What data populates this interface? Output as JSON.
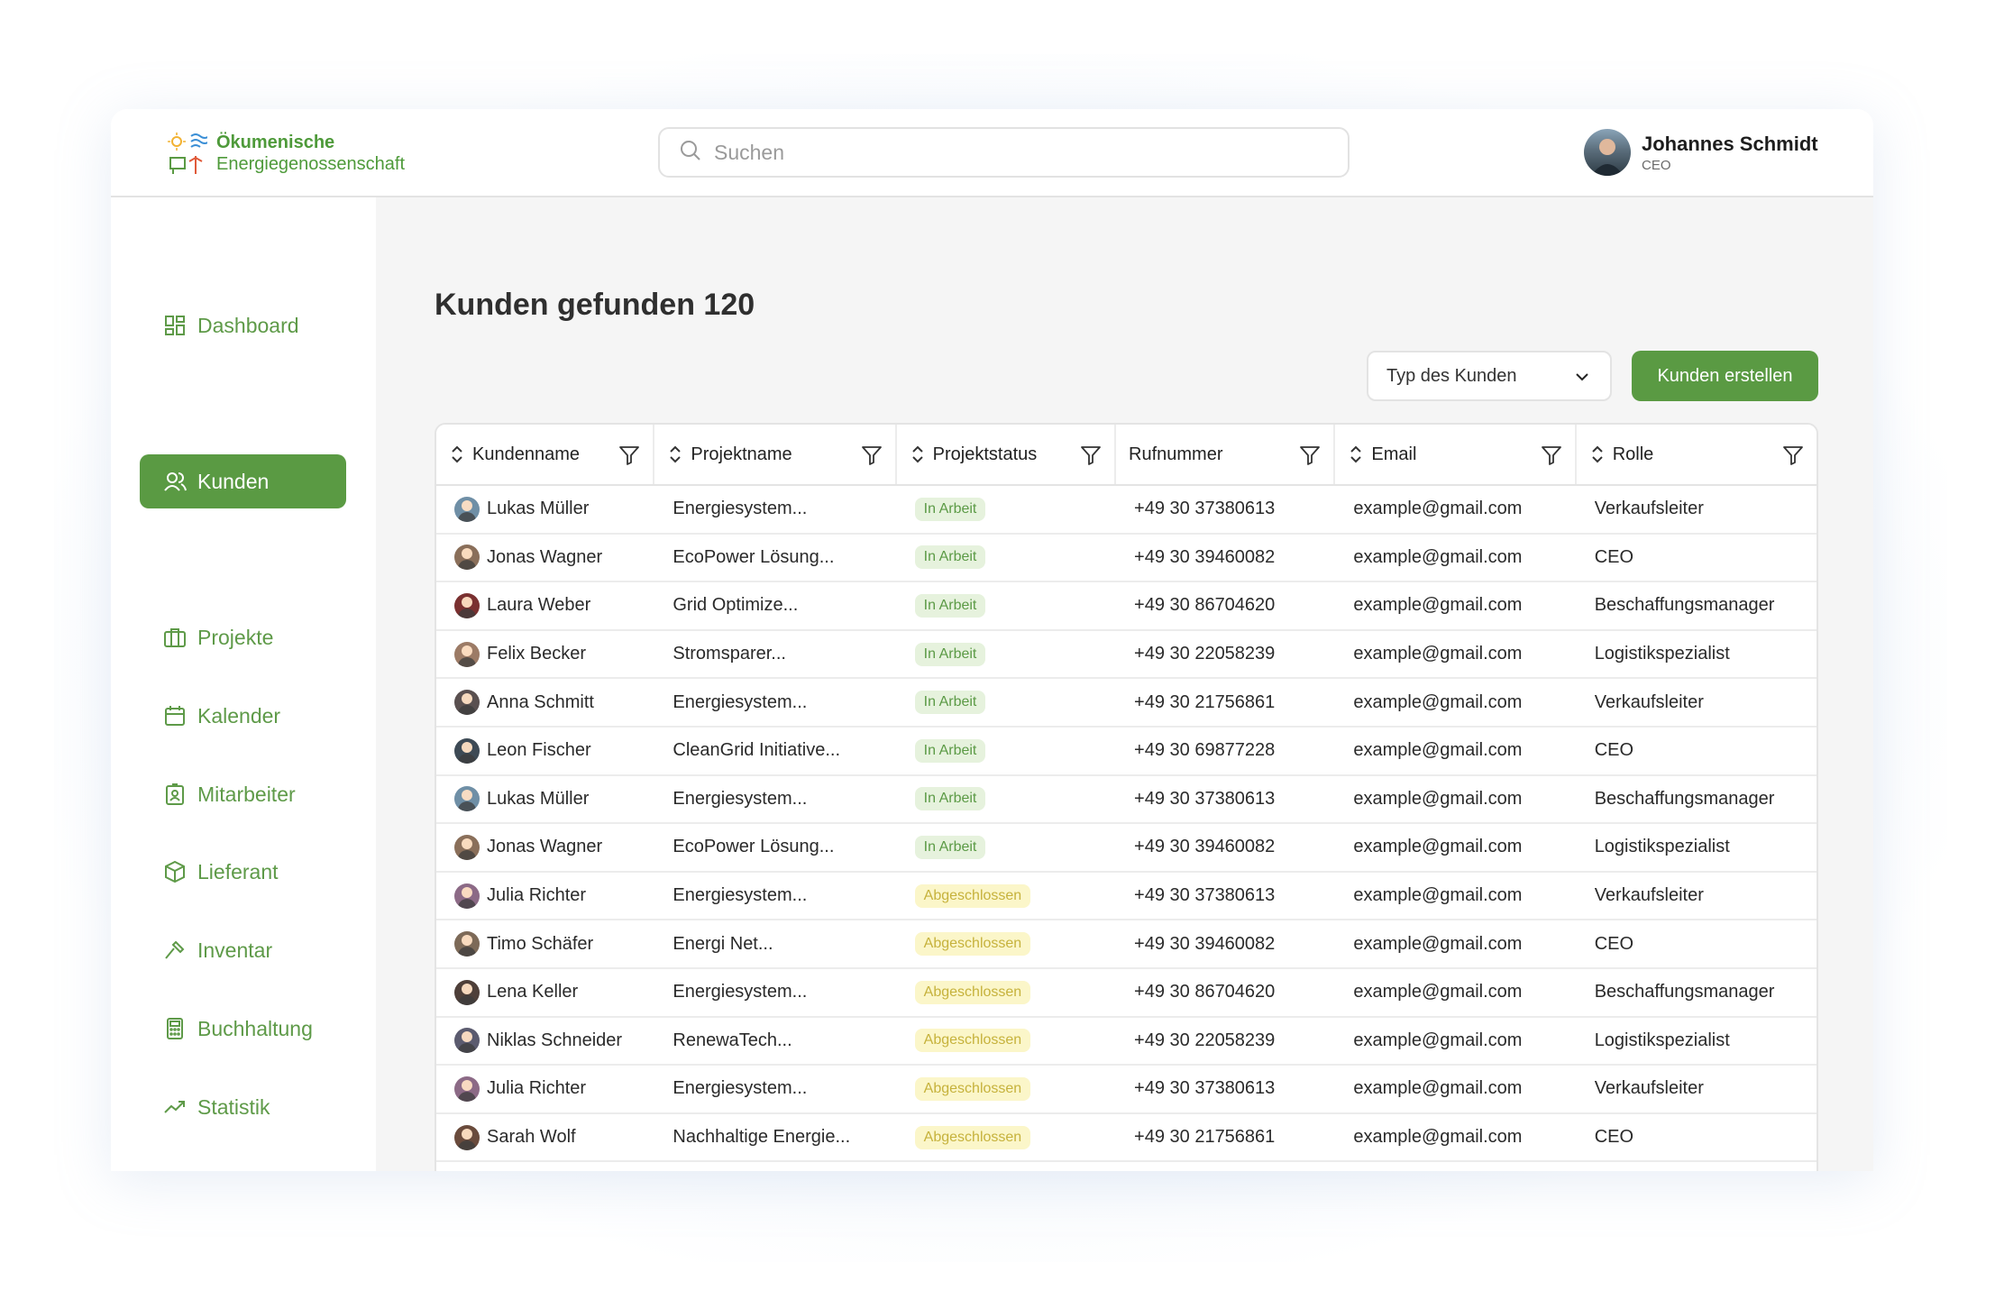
{
  "brand": {
    "line1": "Ökumenische",
    "line2": "Energiegenossenschaft"
  },
  "search": {
    "placeholder": "Suchen"
  },
  "user": {
    "name": "Johannes Schmidt",
    "role": "CEO"
  },
  "sidebar": {
    "items": [
      {
        "label": "Dashboard",
        "icon": "dashboard-icon",
        "active": false
      },
      {
        "label": "Kunden",
        "icon": "users-icon",
        "active": true
      },
      {
        "label": "Projekte",
        "icon": "briefcase-icon",
        "active": false
      },
      {
        "label": "Kalender",
        "icon": "calendar-icon",
        "active": false
      },
      {
        "label": "Mitarbeiter",
        "icon": "id-badge-icon",
        "active": false
      },
      {
        "label": "Lieferant",
        "icon": "box-icon",
        "active": false
      },
      {
        "label": "Inventar",
        "icon": "hammer-icon",
        "active": false
      },
      {
        "label": "Buchhaltung",
        "icon": "calculator-icon",
        "active": false
      },
      {
        "label": "Statistik",
        "icon": "trend-up-icon",
        "active": false
      }
    ]
  },
  "main": {
    "title": "Kunden gefunden 120",
    "type_select": "Typ des Kunden",
    "create_button": "Kunden erstellen"
  },
  "table": {
    "columns": [
      "Kundenname",
      "Projektname",
      "Projektstatus",
      "Rufnummer",
      "Email",
      "Rolle"
    ],
    "status_colors": {
      "In Arbeit": "#5b9a45",
      "Abgeschlossen": "#c6b23c"
    },
    "rows": [
      {
        "name": "Lukas Müller",
        "project": "Energiesystem...",
        "status": "In Arbeit",
        "phone": "+49 30 37380613",
        "email": "example@gmail.com",
        "role": "Verkaufsleiter"
      },
      {
        "name": "Jonas Wagner",
        "project": "EcoPower Lösung...",
        "status": "In Arbeit",
        "phone": "+49 30 39460082",
        "email": "example@gmail.com",
        "role": "CEO"
      },
      {
        "name": "Laura Weber",
        "project": "Grid Optimize...",
        "status": "In Arbeit",
        "phone": "+49 30 86704620",
        "email": "example@gmail.com",
        "role": "Beschaffungsmanager"
      },
      {
        "name": "Felix Becker",
        "project": "Stromsparer...",
        "status": "In Arbeit",
        "phone": "+49 30 22058239",
        "email": "example@gmail.com",
        "role": "Logistikspezialist"
      },
      {
        "name": "Anna Schmitt",
        "project": "Energiesystem...",
        "status": "In Arbeit",
        "phone": "+49 30 21756861",
        "email": "example@gmail.com",
        "role": "Verkaufsleiter"
      },
      {
        "name": "Leon Fischer",
        "project": "CleanGrid Initiative...",
        "status": "In Arbeit",
        "phone": "+49 30 69877228",
        "email": "example@gmail.com",
        "role": "CEO"
      },
      {
        "name": "Lukas Müller",
        "project": "Energiesystem...",
        "status": "In Arbeit",
        "phone": "+49 30 37380613",
        "email": "example@gmail.com",
        "role": "Beschaffungsmanager"
      },
      {
        "name": "Jonas Wagner",
        "project": "EcoPower Lösung...",
        "status": "In Arbeit",
        "phone": "+49 30 39460082",
        "email": "example@gmail.com",
        "role": "Logistikspezialist"
      },
      {
        "name": "Julia Richter",
        "project": "Energiesystem...",
        "status": "Abgeschlossen",
        "phone": "+49 30 37380613",
        "email": "example@gmail.com",
        "role": "Verkaufsleiter"
      },
      {
        "name": "Timo Schäfer",
        "project": "Energi Net...",
        "status": "Abgeschlossen",
        "phone": "+49 30 39460082",
        "email": "example@gmail.com",
        "role": "CEO"
      },
      {
        "name": "Lena Keller",
        "project": "Energiesystem...",
        "status": "Abgeschlossen",
        "phone": "+49 30 86704620",
        "email": "example@gmail.com",
        "role": "Beschaffungsmanager"
      },
      {
        "name": "Niklas Schneider",
        "project": "RenewaTech...",
        "status": "Abgeschlossen",
        "phone": "+49 30 22058239",
        "email": "example@gmail.com",
        "role": "Logistikspezialist"
      },
      {
        "name": "Julia Richter",
        "project": "Energiesystem...",
        "status": "Abgeschlossen",
        "phone": "+49 30 37380613",
        "email": "example@gmail.com",
        "role": "Verkaufsleiter"
      },
      {
        "name": "Sarah Wolf",
        "project": "Nachhaltige Energie...",
        "status": "Abgeschlossen",
        "phone": "+49 30 21756861",
        "email": "example@gmail.com",
        "role": "CEO"
      }
    ]
  },
  "colors": {
    "brand_green": "#5a9a43",
    "main_bg": "#f5f5f5"
  }
}
